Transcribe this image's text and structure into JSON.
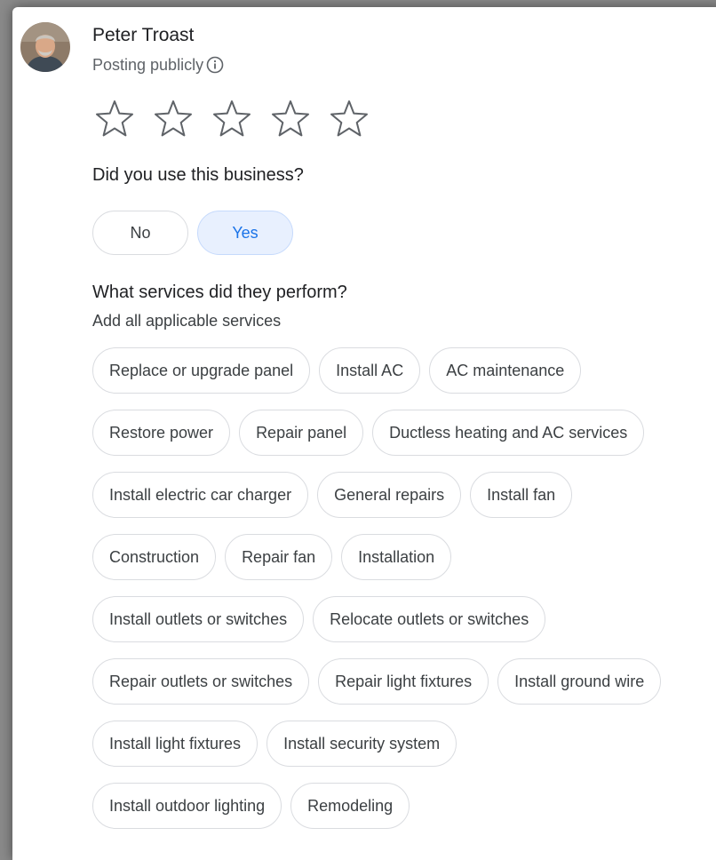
{
  "user": {
    "name": "Peter Troast",
    "posting_status": "Posting publicly"
  },
  "rating": {
    "max_stars": 5,
    "selected": 0
  },
  "question_used": {
    "text": "Did you use this business?",
    "options": [
      "No",
      "Yes"
    ],
    "selected": "Yes"
  },
  "question_services": {
    "text": "What services did they perform?",
    "subtitle": "Add all applicable services",
    "chip_rows": [
      [
        "Replace or upgrade panel",
        "Install AC",
        "AC maintenance"
      ],
      [
        "Restore power",
        "Repair panel",
        "Ductless heating and AC services"
      ],
      [
        "Install electric car charger",
        "General repairs",
        "Install fan"
      ],
      [
        "Construction",
        "Repair fan",
        "Installation"
      ],
      [
        "Install outlets or switches",
        "Relocate outlets or switches"
      ],
      [
        "Repair outlets or switches",
        "Repair light fixtures",
        "Install ground wire"
      ],
      [
        "Install light fixtures",
        "Install security system"
      ],
      [
        "Install outdoor lighting",
        "Remodeling"
      ]
    ]
  },
  "colors": {
    "accent": "#1a73e8",
    "selected_bg": "#e8f0fe",
    "chip_border": "#dadce0",
    "text_primary": "#202124",
    "text_secondary": "#5f6368"
  },
  "icons": {
    "info": "info-circle-icon",
    "star": "star-outline-icon"
  }
}
